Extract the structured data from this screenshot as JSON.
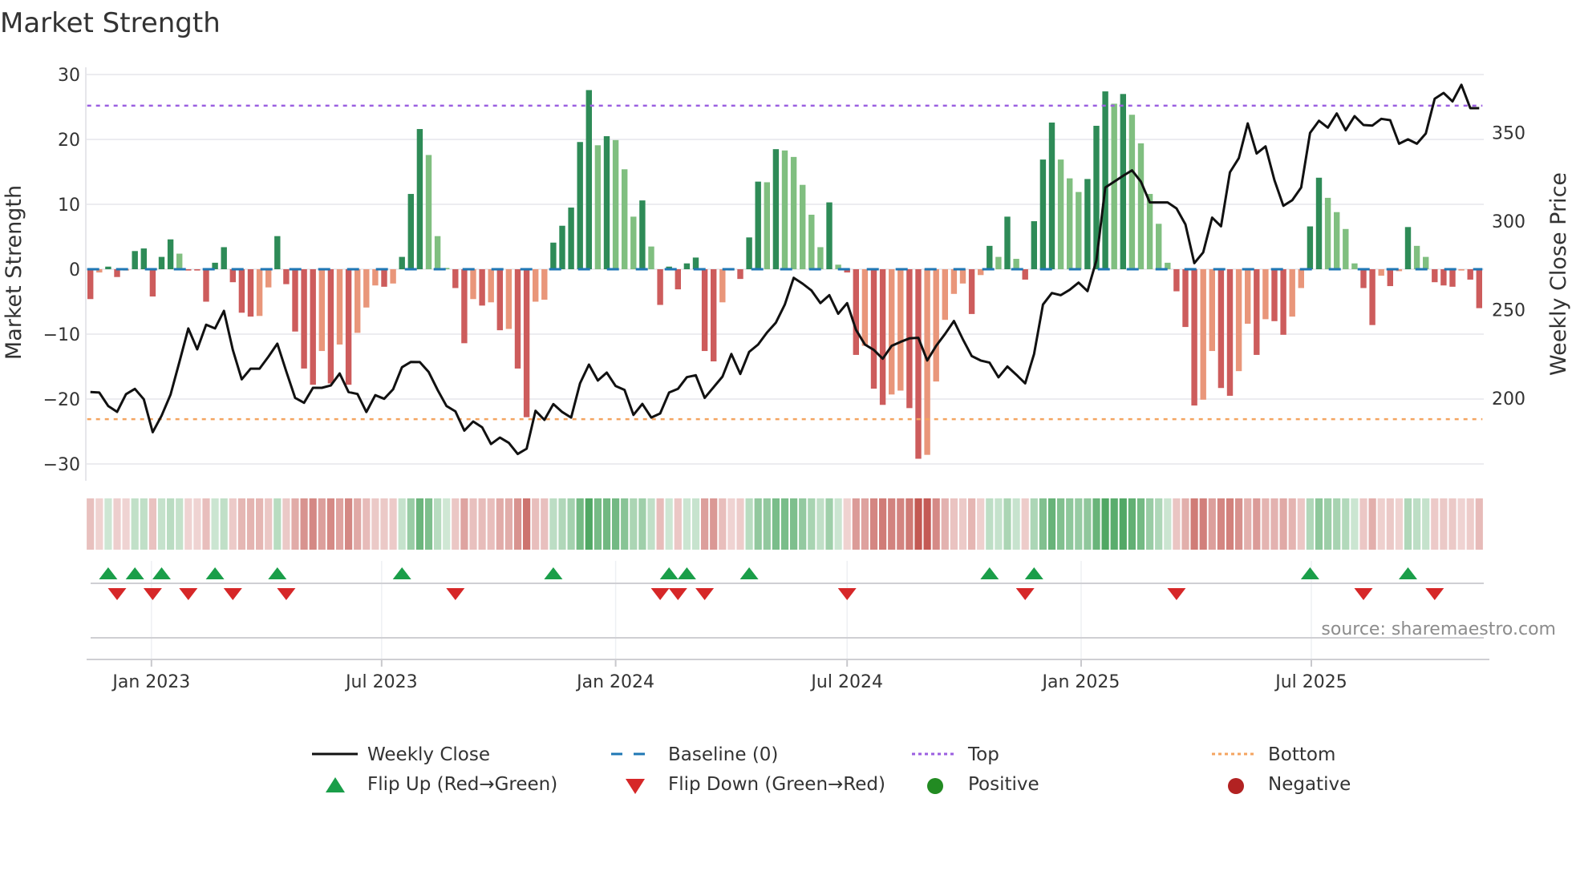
{
  "title": "Market Strength",
  "source": "source: sharemaestro.com",
  "chart_data": {
    "type": "bar",
    "title": "Market Strength",
    "ylabel": "Market Strength",
    "y2label": "Weekly Close Price",
    "ylim": [
      -31.2,
      31.2
    ],
    "y2lim": [
      163.3,
      383.3
    ],
    "grid": true,
    "frequency": "weekly",
    "start_date": "2022-11-14",
    "yticks": [
      "30",
      "20",
      "10",
      "0",
      "−10",
      "−20",
      "−30"
    ],
    "ytick_values": [
      30,
      20,
      10,
      0,
      -10,
      -20,
      -30
    ],
    "y2ticks": [
      "200",
      "250",
      "300",
      "350"
    ],
    "y2tick_values": [
      200,
      250,
      300,
      350
    ],
    "xticks": [
      {
        "label": "Jan 2023",
        "date": "2023-01-01"
      },
      {
        "label": "Jul 2023",
        "date": "2023-07-01"
      },
      {
        "label": "Jan 2024",
        "date": "2024-01-01"
      },
      {
        "label": "Jul 2024",
        "date": "2024-07-01"
      },
      {
        "label": "Jan 2025",
        "date": "2025-01-01"
      },
      {
        "label": "Jul 2025",
        "date": "2025-07-01"
      }
    ],
    "top_level": 25.2,
    "bottom_level": -23.1,
    "baseline": 0,
    "strength": [
      -4.6,
      -0.5,
      0.4,
      -1.2,
      -0.2,
      2.8,
      3.2,
      -4.2,
      1.9,
      4.6,
      2.4,
      -0.2,
      -0.2,
      -5.0,
      1.0,
      3.4,
      -2.0,
      -6.7,
      -7.3,
      -7.2,
      -2.8,
      5.1,
      -2.3,
      -9.6,
      -15.3,
      -17.8,
      -12.6,
      -17.6,
      -11.6,
      -17.8,
      -9.8,
      -5.9,
      -2.5,
      -2.7,
      -2.2,
      1.9,
      11.6,
      21.6,
      17.6,
      5.1,
      0.2,
      -2.9,
      -11.4,
      -4.6,
      -5.6,
      -5.1,
      -9.4,
      -9.2,
      -15.3,
      -22.8,
      -5.0,
      -4.7,
      4.1,
      6.7,
      9.5,
      19.6,
      27.6,
      19.1,
      20.5,
      19.9,
      15.4,
      8.1,
      10.6,
      3.5,
      -5.5,
      0.4,
      -3.1,
      0.9,
      1.8,
      -12.6,
      -14.2,
      -5.1,
      -0.2,
      -1.5,
      4.9,
      13.5,
      13.4,
      18.5,
      18.3,
      17.3,
      13.0,
      8.4,
      3.4,
      10.3,
      0.7,
      -0.5,
      -13.2,
      -11.8,
      -18.4,
      -20.9,
      -19.3,
      -18.7,
      -21.4,
      -29.2,
      -28.6,
      -17.3,
      -7.8,
      -3.8,
      -2.2,
      -6.9,
      -0.9,
      3.6,
      1.9,
      8.1,
      1.6,
      -1.6,
      7.4,
      16.9,
      22.6,
      16.9,
      14.0,
      11.9,
      13.9,
      22.1,
      27.4,
      25.5,
      27.0,
      23.8,
      19.4,
      11.6,
      7.0,
      1.0,
      -3.4,
      -8.9,
      -21.0,
      -20.1,
      -12.6,
      -18.3,
      -19.5,
      -15.7,
      -8.4,
      -13.2,
      -7.7,
      -8.0,
      -10.1,
      -7.3,
      -2.9,
      6.6,
      14.1,
      11.0,
      8.8,
      6.2,
      0.9,
      -2.9,
      -8.6,
      -1.0,
      -2.6,
      -0.3,
      6.5,
      3.6,
      1.9,
      -2.0,
      -2.5,
      -2.7,
      -0.2,
      -1.6,
      -6.0
    ],
    "weekly_close": [
      203.5,
      203.2,
      195.6,
      192.3,
      202.3,
      205.3,
      199.4,
      180.8,
      190.2,
      202.0,
      220.5,
      239.4,
      227.6,
      241.5,
      239.4,
      249.3,
      227.3,
      210.7,
      216.7,
      216.7,
      223.5,
      230.8,
      215.2,
      200.2,
      197.4,
      205.9,
      205.9,
      207.2,
      214.0,
      203.5,
      202.4,
      192.2,
      201.7,
      199.7,
      205.0,
      217.5,
      220.5,
      220.4,
      214.8,
      204.7,
      195.6,
      192.6,
      181.7,
      186.9,
      183.6,
      174.1,
      177.8,
      174.8,
      168.5,
      171.5,
      192.9,
      187.8,
      196.7,
      192.2,
      189.1,
      208.4,
      219.0,
      210.0,
      214.5,
      206.9,
      204.7,
      190.6,
      196.8,
      189.1,
      191.4,
      203.2,
      205.3,
      211.9,
      213.0,
      200.2,
      206.2,
      212.2,
      225.0,
      213.7,
      226.2,
      230.3,
      237.1,
      242.7,
      252.9,
      268.0,
      264.7,
      260.8,
      253.7,
      258.2,
      247.7,
      253.7,
      238.6,
      230.3,
      227.3,
      222.3,
      229.6,
      231.8,
      233.8,
      234.1,
      221.3,
      229.6,
      236.3,
      243.6,
      233.3,
      223.8,
      221.3,
      220.1,
      211.8,
      217.9,
      213.3,
      208.4,
      225.0,
      252.9,
      259.4,
      258.2,
      261.2,
      265.3,
      260.5,
      277.8,
      319.0,
      322.3,
      325.6,
      328.7,
      322.3,
      310.6,
      310.6,
      310.6,
      307.2,
      298.2,
      276.3,
      282.4,
      302.0,
      297.1,
      327.6,
      335.6,
      355.2,
      338.2,
      342.2,
      323.1,
      308.7,
      311.8,
      319.0,
      349.8,
      356.7,
      352.8,
      360.8,
      351.3,
      359.3,
      354.3,
      354.0,
      357.8,
      357.0,
      343.7,
      346.2,
      343.7,
      349.5,
      369.1,
      372.4,
      367.6,
      377.0,
      363.8,
      363.8
    ],
    "flip_up_weeks": [
      2,
      5,
      8,
      14,
      21,
      35,
      52,
      65,
      67,
      74,
      101,
      106,
      137,
      148
    ],
    "flip_down_weeks": [
      3,
      7,
      11,
      16,
      22,
      41,
      64,
      66,
      69,
      85,
      105,
      122,
      143,
      151
    ],
    "legend": {
      "placement": "bottom",
      "items": [
        {
          "label": "Weekly Close"
        },
        {
          "label": "Baseline (0)"
        },
        {
          "label": "Top"
        },
        {
          "label": "Bottom"
        },
        {
          "label": "Flip Up (Red→Green)"
        },
        {
          "label": "Flip Down (Green→Red)"
        },
        {
          "label": "Positive"
        },
        {
          "label": "Negative"
        }
      ]
    }
  },
  "colors": {
    "strong_green": "#2e8b57",
    "weak_green": "#80bf80",
    "strong_red": "#cd5c5c",
    "weak_red": "#e9967a",
    "heat_green": "#3f9f55",
    "heat_red": "#c0504a",
    "price_line": "#111111",
    "baseline": "#1f77b4",
    "top": "#9b5fe0",
    "bottom": "#f4a460",
    "flip_up": "#1a9e49",
    "flip_down": "#d62728",
    "positive": "#228b22",
    "negative": "#b22222",
    "grid": "#ececf0"
  }
}
